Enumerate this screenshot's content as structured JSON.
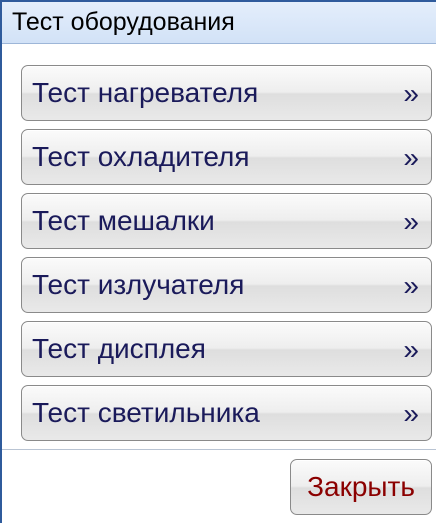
{
  "window": {
    "title": "Тест оборудования"
  },
  "buttons": [
    {
      "label": "Тест нагревателя",
      "arrow": "»"
    },
    {
      "label": "Тест охладителя",
      "arrow": "»"
    },
    {
      "label": "Тест мешалки",
      "arrow": "»"
    },
    {
      "label": "Тест излучателя",
      "arrow": "»"
    },
    {
      "label": "Тест дисплея",
      "arrow": "»"
    },
    {
      "label": "Тест светильника",
      "arrow": "»"
    }
  ],
  "footer": {
    "close_label": "Закрыть"
  },
  "colors": {
    "label_text": "#1a1a5a",
    "close_text": "#8b0000",
    "titlebar_bg": "#d2e2f7"
  }
}
